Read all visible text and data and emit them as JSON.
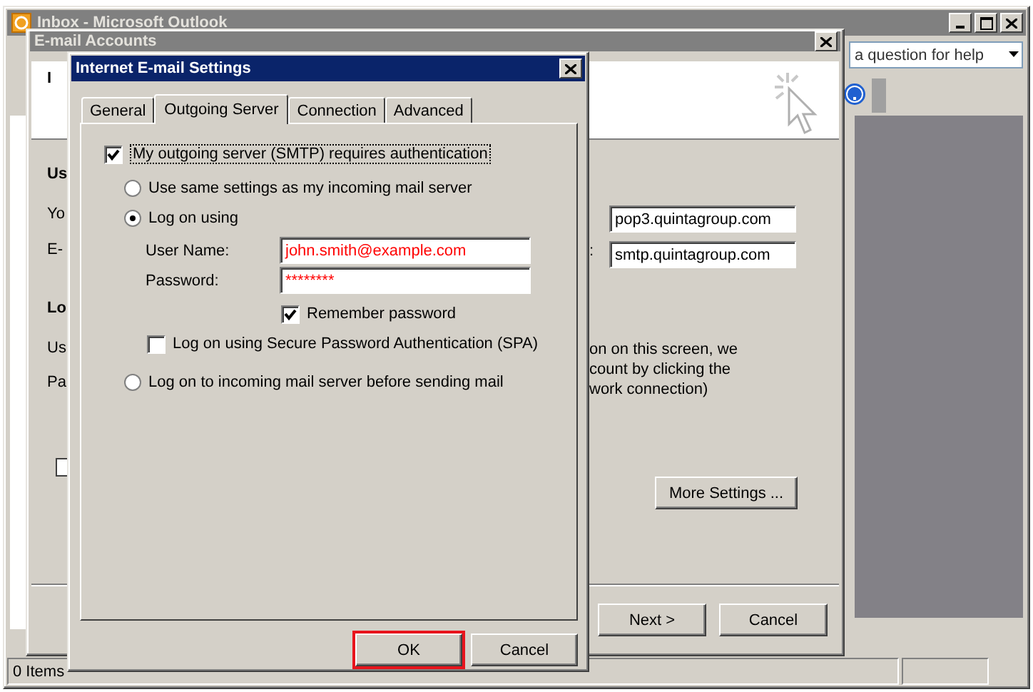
{
  "main_window": {
    "title": "Inbox - Microsoft Outlook",
    "active": false
  },
  "help_box": {
    "value": "a question for help"
  },
  "status_bar": {
    "text": "0 Items"
  },
  "accounts_dialog": {
    "title": "E-mail Accounts",
    "active": false,
    "fragments": [
      {
        "text": "I",
        "kind": "heading"
      },
      {
        "text": "Us",
        "kind": "heading"
      },
      {
        "text": "Yo",
        "kind": "label"
      },
      {
        "text": "E-",
        "kind": "label"
      },
      {
        "text": "Lo",
        "kind": "heading"
      },
      {
        "text": "Us",
        "kind": "label"
      },
      {
        "text": "Pa",
        "kind": "label"
      }
    ],
    "incoming_server": "pop3.quintagroup.com",
    "outgoing_label": ":",
    "outgoing_server": "smtp.quintagroup.com",
    "note_lines": [
      "on on this screen, we",
      "count by clicking the",
      "work connection)"
    ],
    "option_checkbox": {
      "checked": false
    },
    "more_settings": "More Settings ...",
    "buttons": [
      "Next >",
      "Cancel"
    ]
  },
  "settings_dialog": {
    "title": "Internet E-mail Settings",
    "active": true,
    "tabs": [
      {
        "label": "General",
        "selected": false
      },
      {
        "label": "Outgoing Server",
        "selected": true
      },
      {
        "label": "Connection",
        "selected": false
      },
      {
        "label": "Advanced",
        "selected": false
      }
    ],
    "auth": {
      "label": "My outgoing server (SMTP) requires authentication",
      "checked": true
    },
    "options": [
      {
        "label": "Use same settings as my incoming mail server",
        "selected": false
      },
      {
        "label": "Log on using",
        "selected": true
      },
      {
        "label": "Log on to incoming mail server before sending mail",
        "selected": false
      }
    ],
    "user_name": {
      "label": "User Name:",
      "value": "john.smith@example.com"
    },
    "password": {
      "label": "Password:",
      "value": "********"
    },
    "remember": {
      "label": "Remember password",
      "checked": true
    },
    "spa": {
      "label": "Log on using Secure Password Authentication (SPA)",
      "checked": false
    },
    "buttons": [
      {
        "label": "OK",
        "highlighted": true
      },
      {
        "label": "Cancel",
        "highlighted": false
      }
    ]
  }
}
